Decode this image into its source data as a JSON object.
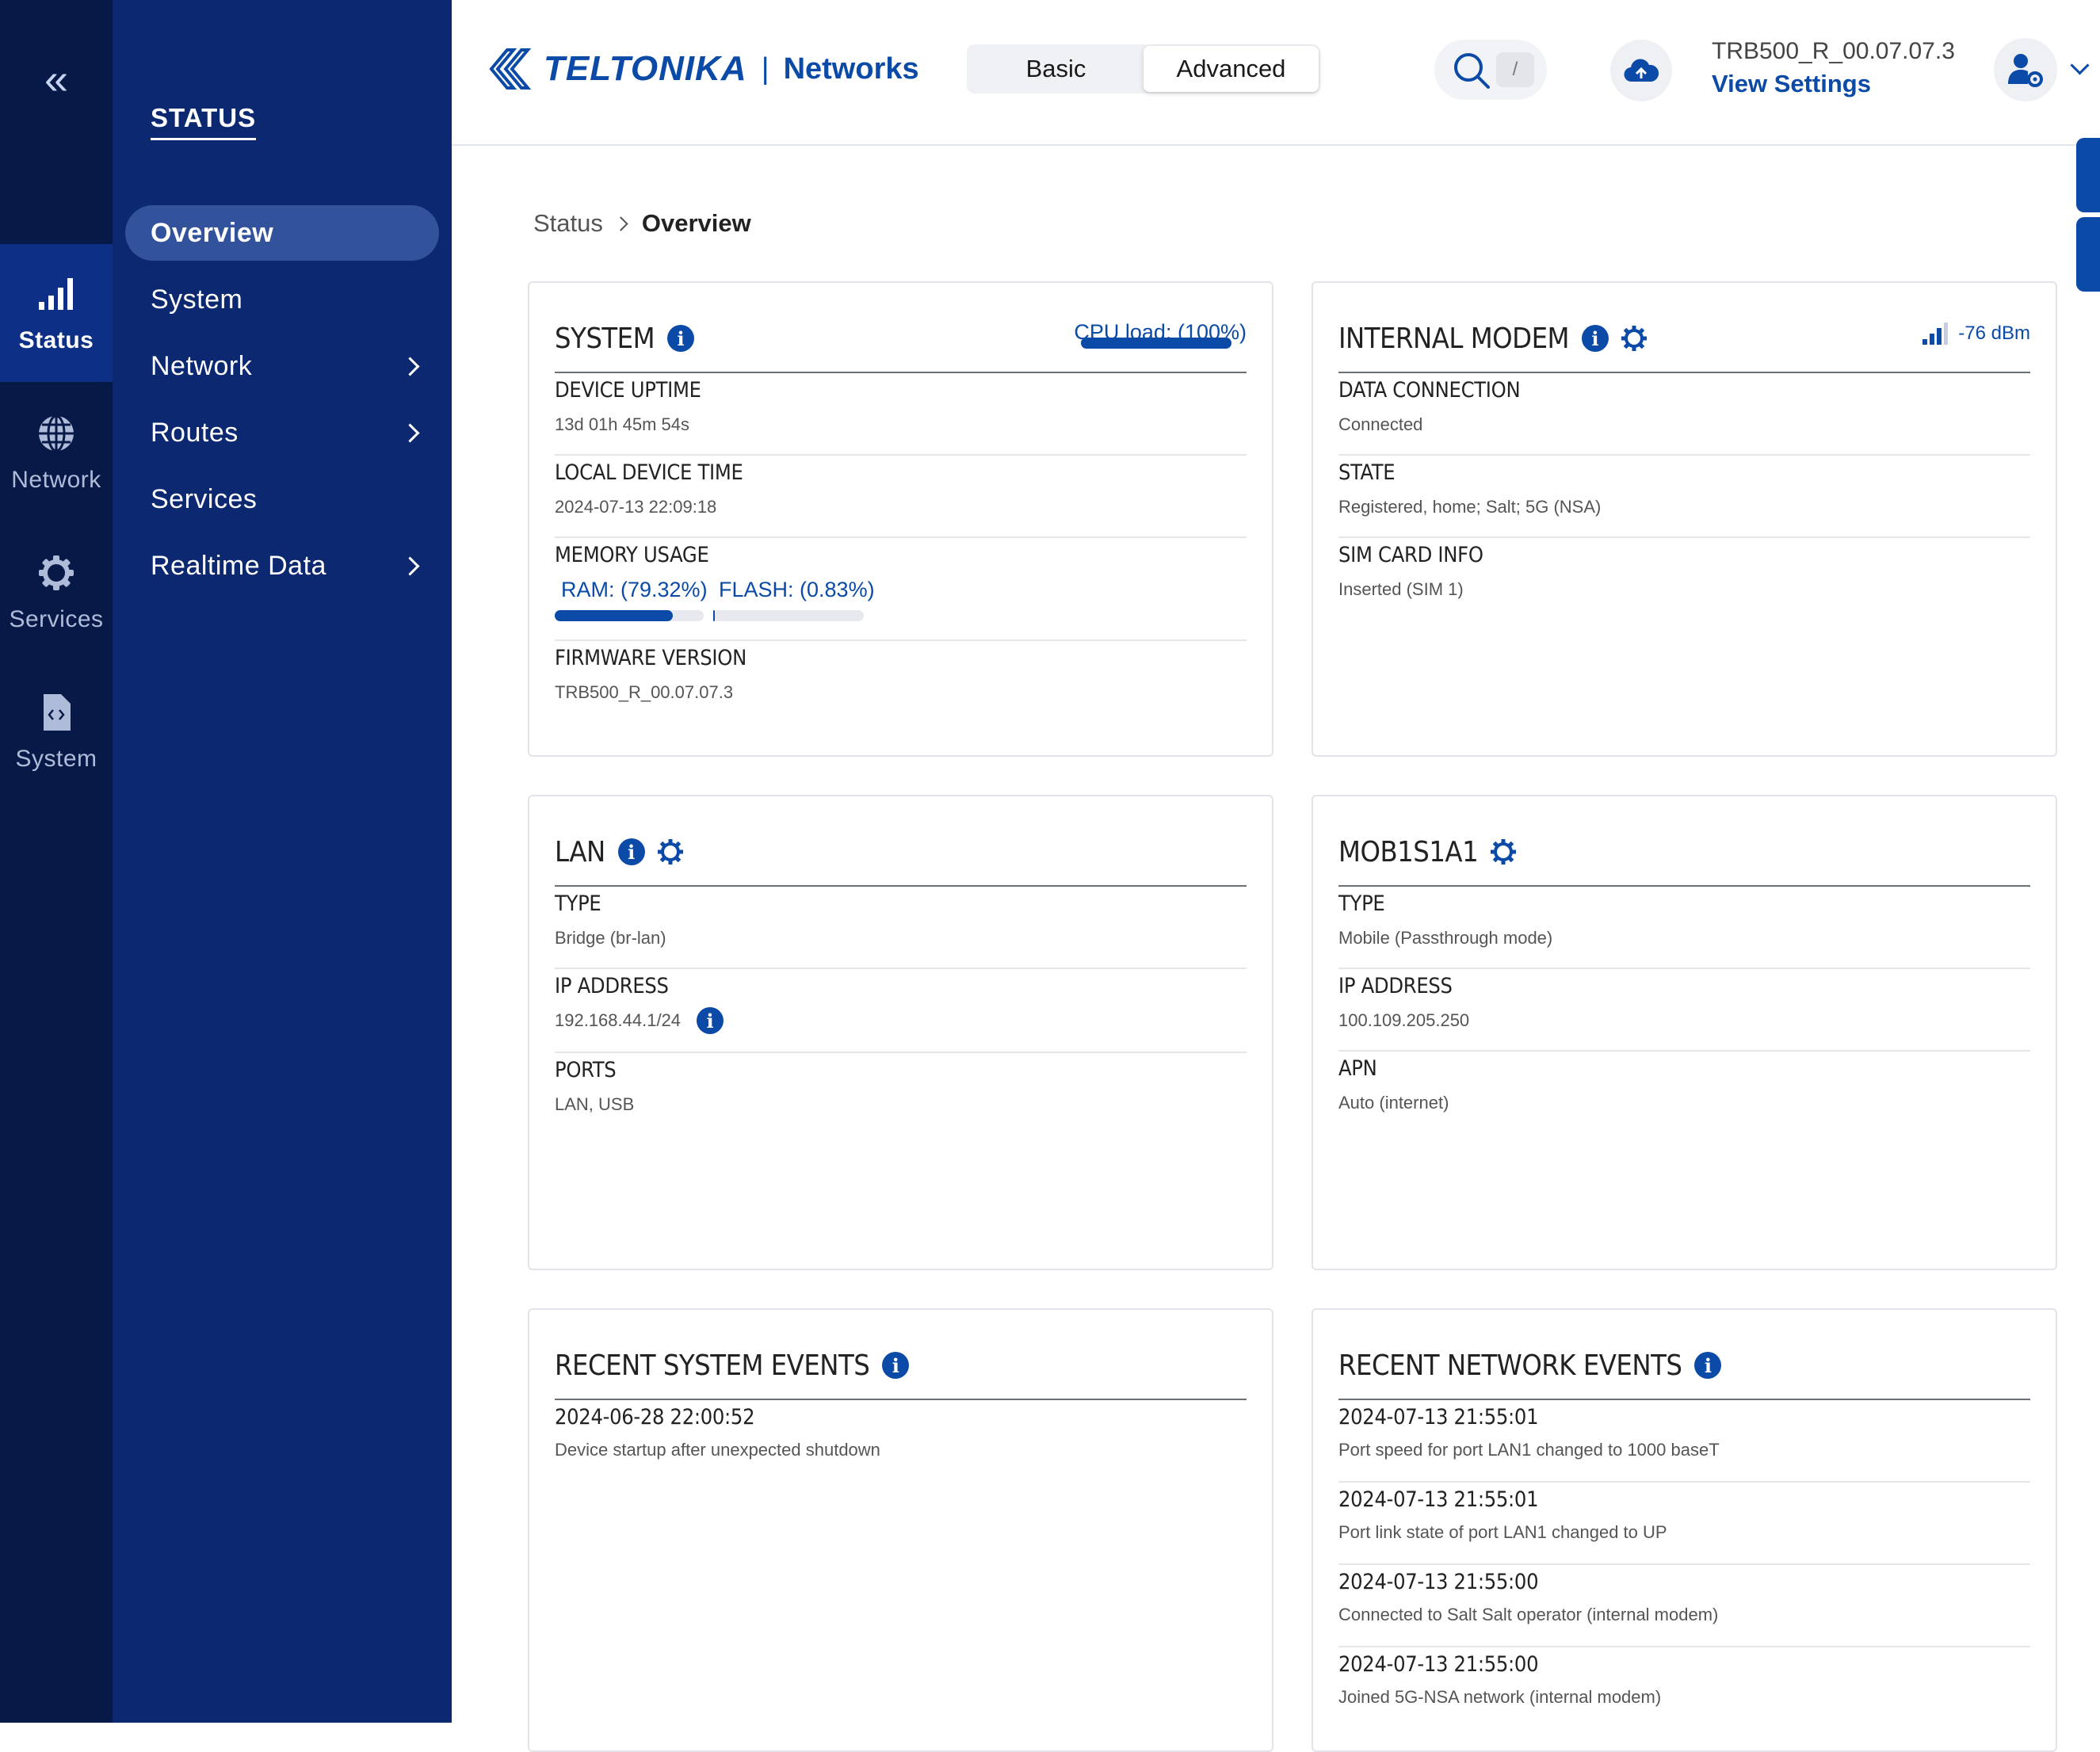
{
  "rail": {
    "items": [
      {
        "label": "Status",
        "icon": "signal-bars-icon"
      },
      {
        "label": "Network",
        "icon": "globe-icon"
      },
      {
        "label": "Services",
        "icon": "gear-icon"
      },
      {
        "label": "System",
        "icon": "code-file-icon"
      }
    ]
  },
  "sidebar": {
    "title": "STATUS",
    "items": [
      {
        "label": "Overview"
      },
      {
        "label": "System"
      },
      {
        "label": "Network"
      },
      {
        "label": "Routes"
      },
      {
        "label": "Services"
      },
      {
        "label": "Realtime Data"
      }
    ]
  },
  "header": {
    "logo_word": "TELTONIKA",
    "logo_sep": "|",
    "logo_networks": "Networks",
    "mode_basic": "Basic",
    "mode_advanced": "Advanced",
    "search_shortcut": "/",
    "firmware": "TRB500_R_00.07.07.3",
    "view_settings": "View Settings"
  },
  "breadcrumb": {
    "parent": "Status",
    "current": "Overview"
  },
  "system_card": {
    "title": "SYSTEM",
    "cpu_label": "CPU load: (100%)",
    "cpu_load": 1.0,
    "rows": {
      "uptime_label": "DEVICE UPTIME",
      "uptime_value": "13d 01h 45m 54s",
      "time_label": "LOCAL DEVICE TIME",
      "time_value": "2024-07-13 22:09:18",
      "memory_label": "MEMORY USAGE",
      "ram_label": "RAM: (79.32%)",
      "ram_usage": 0.7932,
      "flash_label": "FLASH: (0.83%)",
      "flash_usage": 0.0083,
      "firmware_label": "FIRMWARE VERSION",
      "firmware_value": "TRB500_R_00.07.07.3"
    }
  },
  "modem_card": {
    "title": "INTERNAL MODEM",
    "signal": "-76 dBm",
    "rows": {
      "data_label": "DATA CONNECTION",
      "data_value": "Connected",
      "state_label": "STATE",
      "state_value": "Registered, home; Salt; 5G (NSA)",
      "sim_label": "SIM CARD INFO",
      "sim_value": "Inserted (SIM 1)"
    }
  },
  "lan_card": {
    "title": "LAN",
    "rows": {
      "type_label": "TYPE",
      "type_value": "Bridge (br-lan)",
      "ip_label": "IP ADDRESS",
      "ip_value": "192.168.44.1/24",
      "ports_label": "PORTS",
      "ports_value": "LAN, USB"
    }
  },
  "mob_card": {
    "title": "MOB1S1A1",
    "rows": {
      "type_label": "TYPE",
      "type_value": "Mobile (Passthrough mode)",
      "ip_label": "IP ADDRESS",
      "ip_value": "100.109.205.250",
      "apn_label": "APN",
      "apn_value": "Auto (internet)"
    }
  },
  "system_events": {
    "title": "RECENT SYSTEM EVENTS",
    "events": [
      {
        "time": "2024-06-28 22:00:52",
        "desc": "Device startup after unexpected shutdown"
      }
    ]
  },
  "network_events": {
    "title": "RECENT NETWORK EVENTS",
    "events": [
      {
        "time": "2024-07-13 21:55:01",
        "desc": "Port speed for port LAN1 changed to 1000 baseT"
      },
      {
        "time": "2024-07-13 21:55:01",
        "desc": "Port link state of port LAN1 changed to UP"
      },
      {
        "time": "2024-07-13 21:55:00",
        "desc": "Connected to Salt Salt operator (internal modem)"
      },
      {
        "time": "2024-07-13 21:55:00",
        "desc": "Joined 5G-NSA network (internal modem)"
      }
    ]
  },
  "colors": {
    "brand": "#0b4aa6",
    "rail": "#071a47",
    "sidebar": "#0b2870"
  }
}
